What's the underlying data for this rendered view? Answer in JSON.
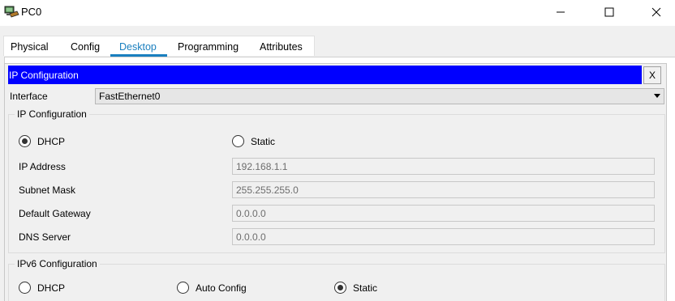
{
  "window": {
    "title": "PC0",
    "icon": "pc-icon",
    "controls": [
      "minimize",
      "maximize",
      "close"
    ]
  },
  "tabs": [
    {
      "label": "Physical",
      "active": false
    },
    {
      "label": "Config",
      "active": false
    },
    {
      "label": "Desktop",
      "active": true
    },
    {
      "label": "Programming",
      "active": false
    },
    {
      "label": "Attributes",
      "active": false
    }
  ],
  "ip_config": {
    "header": "IP Configuration",
    "close_label": "X",
    "interface_label": "Interface",
    "interface_value": "FastEthernet0",
    "ipv4": {
      "title": "IP Configuration",
      "mode_options": [
        "DHCP",
        "Static"
      ],
      "selected_mode": "DHCP",
      "fields": [
        {
          "label": "IP Address",
          "value": "192.168.1.1"
        },
        {
          "label": "Subnet Mask",
          "value": "255.255.255.0"
        },
        {
          "label": "Default Gateway",
          "value": "0.0.0.0"
        },
        {
          "label": "DNS Server",
          "value": "0.0.0.0"
        }
      ]
    },
    "ipv6": {
      "title": "IPv6 Configuration",
      "mode_options": [
        "DHCP",
        "Auto Config",
        "Static"
      ],
      "selected_mode": "Static"
    }
  },
  "colors": {
    "header_bar": "#0000ff",
    "active_tab": "#1a7fbf"
  }
}
